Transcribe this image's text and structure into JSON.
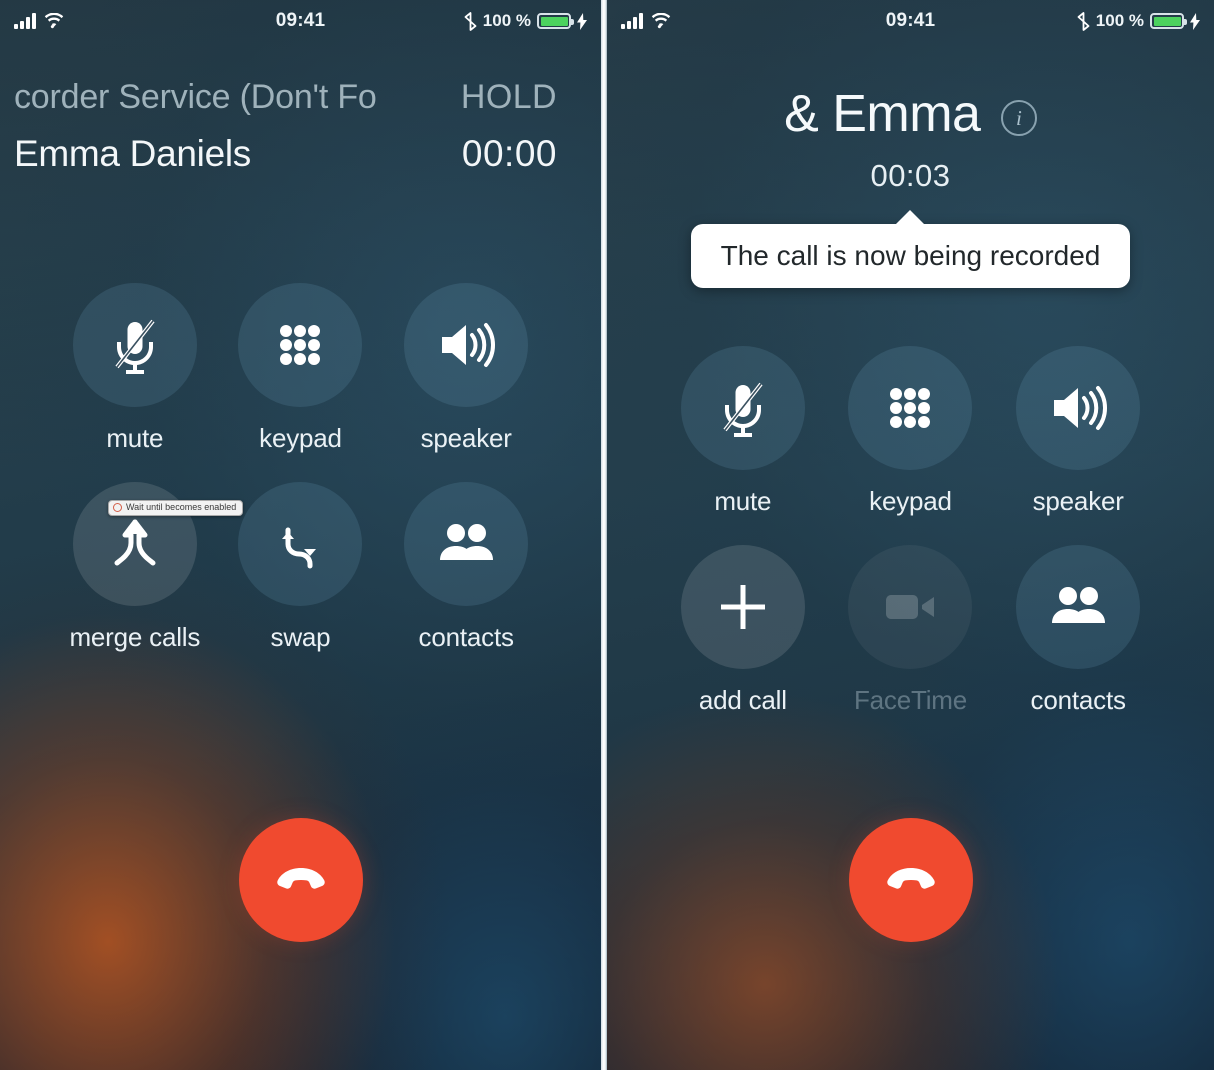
{
  "statusbar": {
    "time": "09:41",
    "battery_percent": "100 %",
    "signal_icon": "cellular-signal-icon",
    "wifi_icon": "wifi-icon",
    "bluetooth_icon": "bluetooth-icon",
    "battery_icon": "battery-icon",
    "charging_icon": "lightning-bolt-icon"
  },
  "left_screen": {
    "service_label": "corder Service (Don't Fo",
    "hold_label": "HOLD",
    "contact_name": "Emma Daniels",
    "timer": "00:00",
    "tooltip": {
      "text": "Wait until becomes enabled",
      "icon": "warning-circle-icon"
    },
    "buttons": [
      {
        "label": "mute",
        "icon": "microphone-muted-icon",
        "state": "enabled"
      },
      {
        "label": "keypad",
        "icon": "dial-keypad-icon",
        "state": "enabled"
      },
      {
        "label": "speaker",
        "icon": "speaker-volume-icon",
        "state": "enabled"
      },
      {
        "label": "merge calls",
        "icon": "merge-calls-icon",
        "state": "enabled"
      },
      {
        "label": "swap",
        "icon": "swap-calls-icon",
        "state": "enabled"
      },
      {
        "label": "contacts",
        "icon": "contacts-people-icon",
        "state": "enabled"
      }
    ],
    "end_call": {
      "label": "",
      "icon": "end-call-handset-icon",
      "color": "#f04a2f"
    }
  },
  "right_screen": {
    "title": "& Emma",
    "info_icon": "info-circle-icon",
    "info_glyph": "i",
    "timer": "00:03",
    "toast": {
      "text": "The call is now being recorded"
    },
    "buttons": [
      {
        "label": "mute",
        "icon": "microphone-muted-icon",
        "state": "enabled"
      },
      {
        "label": "keypad",
        "icon": "dial-keypad-icon",
        "state": "enabled"
      },
      {
        "label": "speaker",
        "icon": "speaker-volume-icon",
        "state": "enabled"
      },
      {
        "label": "add call",
        "icon": "plus-icon",
        "state": "enabled"
      },
      {
        "label": "FaceTime",
        "icon": "facetime-video-icon",
        "state": "disabled"
      },
      {
        "label": "contacts",
        "icon": "contacts-people-icon",
        "state": "enabled"
      }
    ],
    "end_call": {
      "label": "",
      "icon": "end-call-handset-icon",
      "color": "#f04a2f"
    }
  },
  "colors": {
    "end_call_red": "#f04a2f",
    "battery_green": "#4cd25e",
    "toast_background": "#ffffff",
    "label_text": "#eaf1f5",
    "muted_text": "#9fb2bb"
  }
}
